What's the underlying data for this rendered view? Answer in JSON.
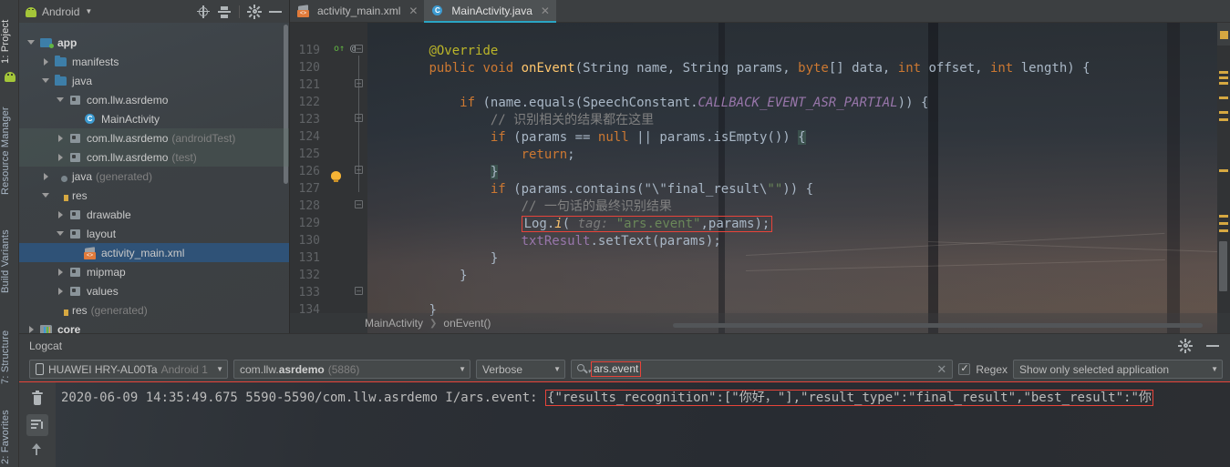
{
  "left_rail": {
    "tabs": [
      {
        "label": "1: Project",
        "selected": true
      },
      {
        "label": "Resource Manager",
        "selected": false
      },
      {
        "label": "Build Variants",
        "selected": false
      },
      {
        "label": "7: Structure",
        "selected": false
      },
      {
        "label": "2: Favorites",
        "selected": false
      }
    ]
  },
  "project_panel": {
    "title": "Android",
    "tools": [
      "locate-icon",
      "collapse-all-icon",
      "settings-icon",
      "minimize-icon"
    ],
    "tree": [
      {
        "label": "app",
        "dim": "",
        "indent": 0,
        "arrow": "down",
        "icon": "module-green",
        "bold": true,
        "state": "normal"
      },
      {
        "label": "manifests",
        "dim": "",
        "indent": 1,
        "arrow": "right",
        "icon": "folder-blue",
        "bold": false,
        "state": "normal"
      },
      {
        "label": "java",
        "dim": "",
        "indent": 1,
        "arrow": "down",
        "icon": "folder-blue",
        "bold": false,
        "state": "normal"
      },
      {
        "label": "com.llw.asrdemo",
        "dim": "",
        "indent": 2,
        "arrow": "down",
        "icon": "package",
        "bold": false,
        "state": "normal"
      },
      {
        "label": "MainActivity",
        "dim": "",
        "indent": 3,
        "arrow": "none",
        "icon": "class",
        "bold": false,
        "state": "normal"
      },
      {
        "label": "com.llw.asrdemo",
        "dim": "(androidTest)",
        "indent": 2,
        "arrow": "right",
        "icon": "package",
        "bold": false,
        "state": "highlight"
      },
      {
        "label": "com.llw.asrdemo",
        "dim": "(test)",
        "indent": 2,
        "arrow": "right",
        "icon": "package",
        "bold": false,
        "state": "highlight"
      },
      {
        "label": "java",
        "dim": "(generated)",
        "indent": 1,
        "arrow": "right",
        "icon": "java-generated",
        "bold": false,
        "state": "normal"
      },
      {
        "label": "res",
        "dim": "",
        "indent": 1,
        "arrow": "down",
        "icon": "res",
        "bold": false,
        "state": "normal"
      },
      {
        "label": "drawable",
        "dim": "",
        "indent": 2,
        "arrow": "right",
        "icon": "package",
        "bold": false,
        "state": "normal"
      },
      {
        "label": "layout",
        "dim": "",
        "indent": 2,
        "arrow": "down",
        "icon": "package",
        "bold": false,
        "state": "normal"
      },
      {
        "label": "activity_main.xml",
        "dim": "",
        "indent": 3,
        "arrow": "none",
        "icon": "xml",
        "bold": false,
        "state": "selected"
      },
      {
        "label": "mipmap",
        "dim": "",
        "indent": 2,
        "arrow": "right",
        "icon": "package",
        "bold": false,
        "state": "normal"
      },
      {
        "label": "values",
        "dim": "",
        "indent": 2,
        "arrow": "right",
        "icon": "package",
        "bold": false,
        "state": "normal"
      },
      {
        "label": "res",
        "dim": "(generated)",
        "indent": 1,
        "arrow": "none",
        "icon": "res-generated",
        "bold": false,
        "state": "normal"
      },
      {
        "label": "core",
        "dim": "",
        "indent": 0,
        "arrow": "right",
        "icon": "core",
        "bold": true,
        "state": "normal"
      }
    ]
  },
  "editor": {
    "tabs": [
      {
        "label": "activity_main.xml",
        "icon": "xml-file-icon",
        "active": false
      },
      {
        "label": "MainActivity.java",
        "icon": "java-class-icon",
        "active": true
      }
    ],
    "first_line_number": 119,
    "line_numbers": [
      119,
      120,
      121,
      122,
      123,
      124,
      125,
      126,
      127,
      128,
      129,
      130,
      131,
      132,
      133,
      134
    ],
    "lines": [
      "        @Override",
      "        public void onEvent(String name, String params, byte[] data, int offset, int length) {",
      "",
      "            if (name.equals(SpeechConstant.CALLBACK_EVENT_ASR_PARTIAL)) {",
      "                // 识别相关的结果都在这里",
      "                if (params == null || params.isEmpty()) {",
      "                    return;",
      "                }",
      "                if (params.contains(\"\\\"final_result\\\"\")) {",
      "                    // 一句话的最终识别结果",
      "                    Log.i( tag: \"ars.event\",params);",
      "                    txtResult.setText(params);",
      "                }",
      "            }",
      "",
      "        }"
    ],
    "highlighted_line_text": "Log.i( tag: \"ars.event\",params);",
    "breadcrumb": [
      "MainActivity",
      "onEvent()"
    ],
    "gutter_marker_line": 120,
    "bulb_line": 126
  },
  "logcat": {
    "title": "Logcat",
    "tools": [
      "settings-icon",
      "minimize-icon"
    ],
    "device": {
      "name": "HUAWEI HRY-AL00Ta",
      "os": "Android 1"
    },
    "process": {
      "package_prefix": "com.llw.",
      "package_suffix": "asrdemo",
      "pid": "(5886)"
    },
    "level": "Verbose",
    "search": {
      "value": "ars.event",
      "placeholder": ""
    },
    "regex_label": "Regex",
    "regex_checked": true,
    "filter": "Show only selected application",
    "side_buttons": [
      "clear-logcat-icon",
      "scroll-to-end-icon",
      "up-arrow-icon"
    ],
    "log_entry": {
      "prefix": "2020-06-09 14:35:49.675 5590-5590/com.llw.asrdemo I/ars.event: ",
      "json": "{\"results_recognition\":[\"你好，\"],\"result_type\":\"final_result\",\"best_result\":\"你"
    }
  },
  "colors": {
    "accent_red": "#e8443a",
    "tab_underline": "#2aa5c4",
    "selection_blue": "#2f5277",
    "keyword_orange": "#cc7832",
    "string_green": "#6a8759",
    "method_yellow": "#ffc66d",
    "annotation_yellow": "#bbb529",
    "constant_purple": "#9876aa",
    "comment_gray": "#808080",
    "text_gray": "#a9b7c6"
  }
}
